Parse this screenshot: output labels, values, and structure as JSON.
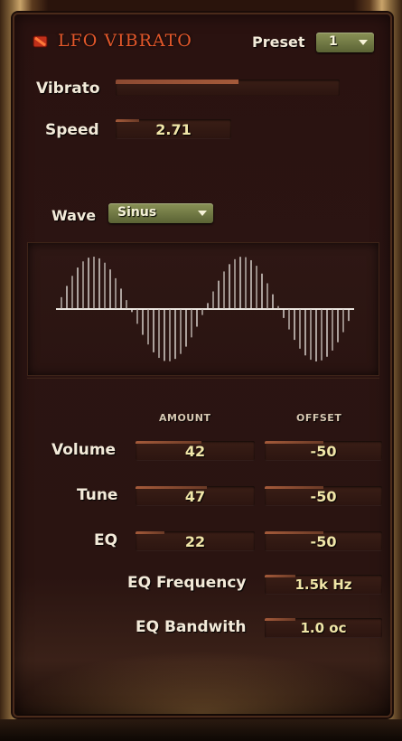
{
  "header": {
    "title": "LFO VIBRATO",
    "preset_label": "Preset",
    "preset_value": "1",
    "icon": "flame-icon",
    "title_color": "#e2572a"
  },
  "vibrato": {
    "label": "Vibrato",
    "level": 0.55
  },
  "speed": {
    "label": "Speed",
    "value": "2.71",
    "level": 0.2
  },
  "wave": {
    "label": "Wave",
    "selected": "Sinus",
    "accent": "#8a9256"
  },
  "table": {
    "columns": [
      "AMOUNT",
      "OFFSET"
    ],
    "rows": [
      {
        "label": "Volume",
        "amount": "42",
        "offset": "-50"
      },
      {
        "label": "Tune",
        "amount": "47",
        "offset": "-50"
      },
      {
        "label": "EQ",
        "amount": "22",
        "offset": "-50"
      }
    ]
  },
  "eq_frequency": {
    "label": "EQ Frequency",
    "value": "1.5k Hz"
  },
  "eq_bandwidth": {
    "label": "EQ Bandwith",
    "value": "1.0 oc"
  },
  "colors": {
    "value_text": "#f1e6a8",
    "label_text": "#f3ead9",
    "panel_bg": "#2a1411"
  }
}
